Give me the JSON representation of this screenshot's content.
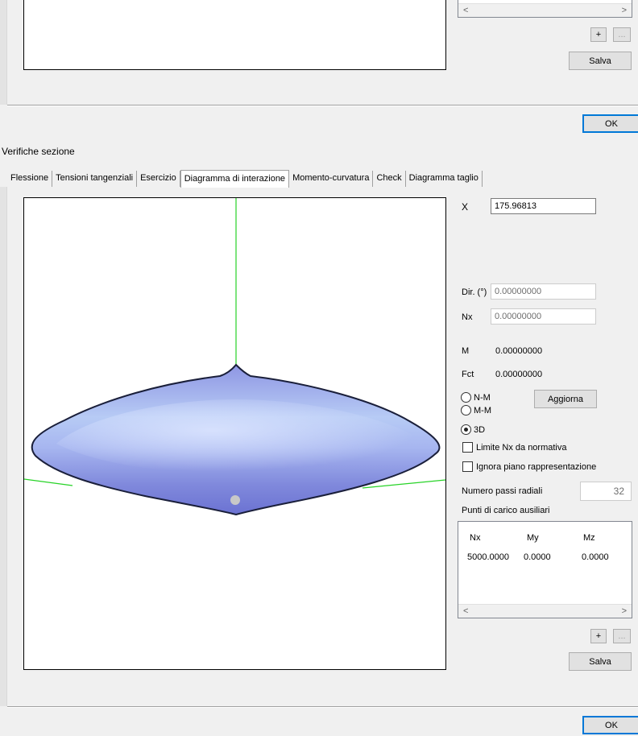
{
  "top_panel": {
    "scroll_left": "<",
    "scroll_right": ">",
    "add_label": "+",
    "more_label": "...",
    "save_label": "Salva",
    "ok_label": "OK"
  },
  "window": {
    "title": "Verifiche sezione"
  },
  "tabs": [
    {
      "label": "Flessione"
    },
    {
      "label": "Tensioni tangenziali"
    },
    {
      "label": "Esercizio"
    },
    {
      "label": "Diagramma di interazione"
    },
    {
      "label": "Momento-curvatura"
    },
    {
      "label": "Check"
    },
    {
      "label": "Diagramma taglio"
    }
  ],
  "panel": {
    "x_label": "X",
    "x_value": "175.96813",
    "dir_label": "Dir. (°)",
    "dir_value": "0.00000000",
    "nx_label": "Nx",
    "nx_value": "0.00000000",
    "m_label": "M",
    "m_value": "0.00000000",
    "fct_label": "Fct",
    "fct_value": "0.00000000",
    "update_label": "Aggiorna",
    "radio_nm": "N-M",
    "radio_mm": "M-M",
    "radio_3d": "3D",
    "selected_mode": "3D",
    "check_limit": "Limite Nx da normativa",
    "check_ignore": "Ignora piano rappresentazione",
    "radial_steps_label": "Numero passi radiali",
    "radial_steps_value": "32",
    "aux_points_label": "Punti di carico ausiliari",
    "table": {
      "headers": [
        "Nx",
        "My",
        "Mz"
      ],
      "rows": [
        [
          "5000.0000",
          "0.0000",
          "0.0000"
        ]
      ]
    },
    "scroll_left": "<",
    "scroll_right": ">",
    "add_label": "+",
    "more_label": "...",
    "save_label": "Salva",
    "ok_label": "OK"
  },
  "colors": {
    "axis": "#27d327",
    "surface_light": "#b8c8f5",
    "surface_dark": "#6e78d8",
    "outline": "#1a1f3a",
    "point": "#c8c8c8",
    "focus": "#0078d7"
  }
}
